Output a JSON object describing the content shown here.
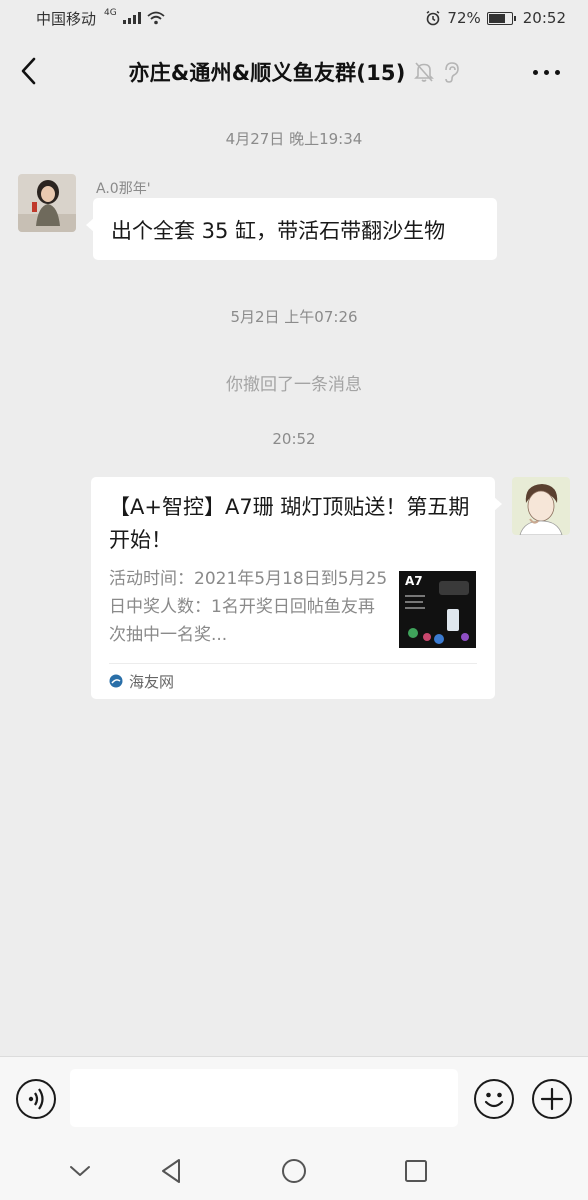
{
  "status_bar": {
    "carrier": "中国移动",
    "network": "4G",
    "battery": "72%",
    "battery_level": 0.72,
    "time": "20:52"
  },
  "header": {
    "title": "亦庄&通州&顺义鱼友群(15)"
  },
  "chat": {
    "time_1": "4月27日 晚上19:34",
    "message_1": {
      "sender": "A.0那年'",
      "text": "出个全套 35 缸，带活石带翻沙生物"
    },
    "time_2": "5月2日 上午07:26",
    "system_message": "你撤回了一条消息",
    "time_3": "20:52",
    "message_2": {
      "title": "【A+智控】A7珊 瑚灯顶贴送！第五期开始！",
      "description": "活动时间：2021年5月18日到5月25日中奖人数：1名开奖日回帖鱼友再次抽中一名奖...",
      "thumbnail_label": "A7",
      "source": "海友网"
    }
  },
  "colors": {
    "background": "#ededed",
    "bubble": "#ffffff",
    "muted_text": "#8b8b8b"
  }
}
